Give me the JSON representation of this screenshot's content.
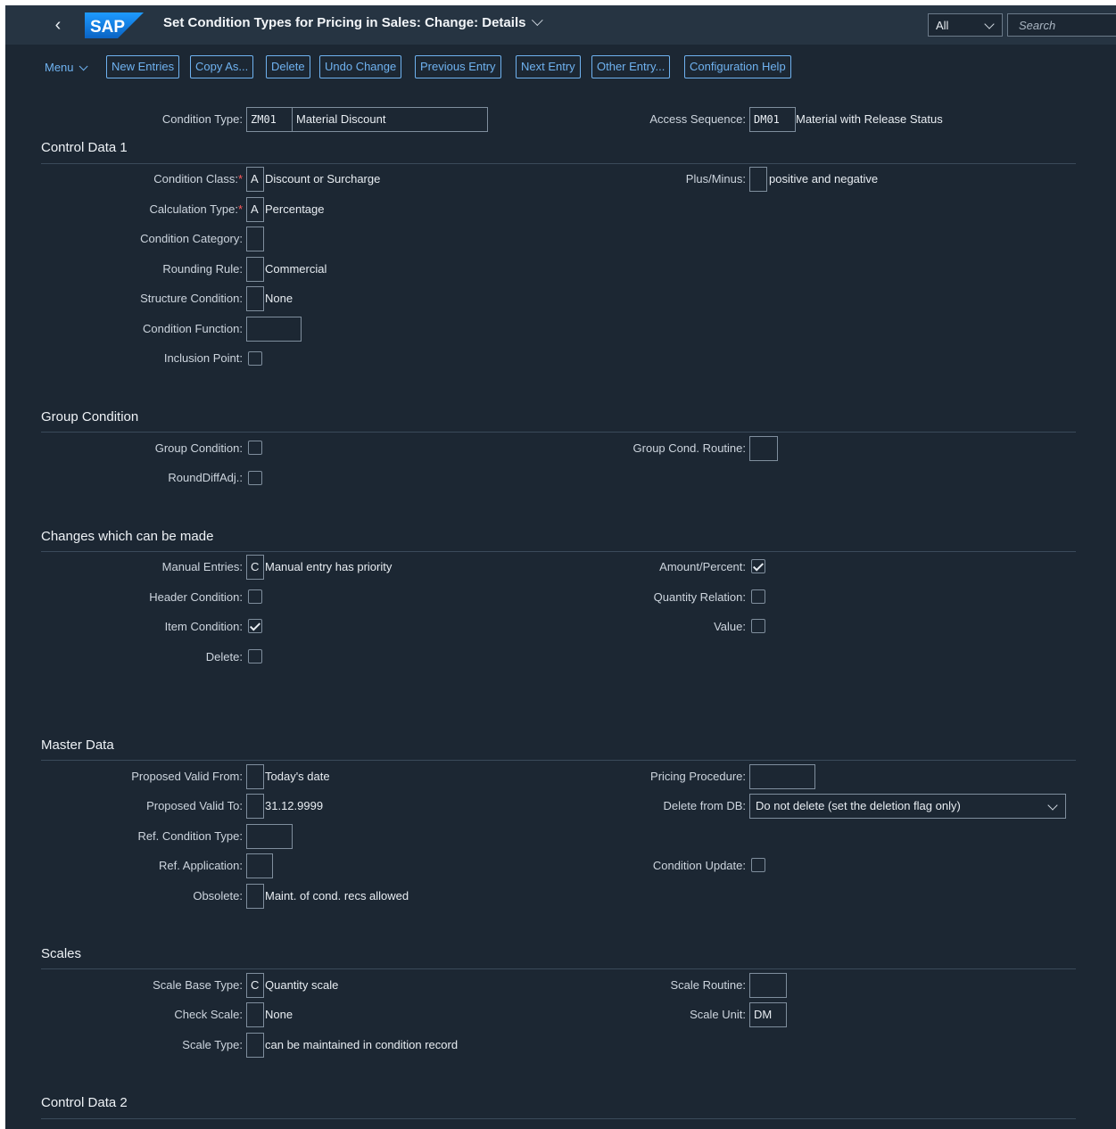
{
  "shell": {
    "logo": "SAP",
    "title": "Set Condition Types for Pricing in Sales: Change: Details",
    "scope": "All",
    "search_placeholder": "Search"
  },
  "toolbar": {
    "menu": "Menu",
    "buttons": [
      "New Entries",
      "Copy As...",
      "Delete",
      "Undo Change",
      "Previous Entry",
      "Next Entry",
      "Other Entry...",
      "Configuration Help"
    ]
  },
  "header": {
    "condition_type_label": "Condition Type:",
    "condition_type": "ZM01",
    "condition_type_desc": "Material Discount",
    "access_sequence_label": "Access Sequence:",
    "access_sequence": "DM01",
    "access_sequence_desc": "Material with Release Status"
  },
  "control_data_1": {
    "title": "Control Data 1",
    "condition_class_label": "Condition Class:",
    "condition_class": "A",
    "condition_class_desc": "Discount or Surcharge",
    "plus_minus_label": "Plus/Minus:",
    "plus_minus": "",
    "plus_minus_desc": "positive and negative",
    "calculation_type_label": "Calculation Type:",
    "calculation_type": "A",
    "calculation_type_desc": "Percentage",
    "condition_category_label": "Condition Category:",
    "rounding_rule_label": "Rounding Rule:",
    "rounding_rule_desc": "Commercial",
    "structure_condition_label": "Structure Condition:",
    "structure_condition_desc": "None",
    "condition_function_label": "Condition Function:",
    "inclusion_point_label": "Inclusion Point:",
    "required_mark": "*"
  },
  "group_condition": {
    "title": "Group Condition",
    "group_condition_label": "Group Condition:",
    "group_cond_routine_label": "Group Cond. Routine:",
    "round_diff_adj_label": "RoundDiffAdj.:"
  },
  "changes": {
    "title": "Changes which can be made",
    "manual_entries_label": "Manual Entries:",
    "manual_entries": "C",
    "manual_entries_desc": "Manual entry has priority",
    "amount_percent_label": "Amount/Percent:",
    "amount_percent_checked": true,
    "header_condition_label": "Header Condition:",
    "header_condition_checked": false,
    "quantity_relation_label": "Quantity Relation:",
    "quantity_relation_checked": false,
    "item_condition_label": "Item Condition:",
    "item_condition_checked": true,
    "value_label": "Value:",
    "value_checked": false,
    "delete_label": "Delete:",
    "delete_checked": false
  },
  "master_data": {
    "title": "Master Data",
    "proposed_valid_from_label": "Proposed Valid From:",
    "proposed_valid_from_desc": "Today's date",
    "pricing_procedure_label": "Pricing Procedure:",
    "proposed_valid_to_label": "Proposed Valid To:",
    "proposed_valid_to_desc": "31.12.9999",
    "delete_from_db_label": "Delete from DB:",
    "delete_from_db": "Do not delete (set the deletion flag only)",
    "ref_condition_type_label": "Ref. Condition Type:",
    "ref_application_label": "Ref. Application:",
    "condition_update_label": "Condition Update:",
    "obsolete_label": "Obsolete:",
    "obsolete_desc": "Maint. of cond. recs allowed"
  },
  "scales": {
    "title": "Scales",
    "scale_base_type_label": "Scale Base Type:",
    "scale_base_type": "C",
    "scale_base_type_desc": "Quantity scale",
    "scale_routine_label": "Scale Routine:",
    "check_scale_label": "Check Scale:",
    "check_scale_desc": "None",
    "scale_unit_label": "Scale Unit:",
    "scale_unit": "DM",
    "scale_type_label": "Scale Type:",
    "scale_type_desc": "can be maintained in condition record"
  },
  "control_data_2": {
    "title": "Control Data 2"
  }
}
